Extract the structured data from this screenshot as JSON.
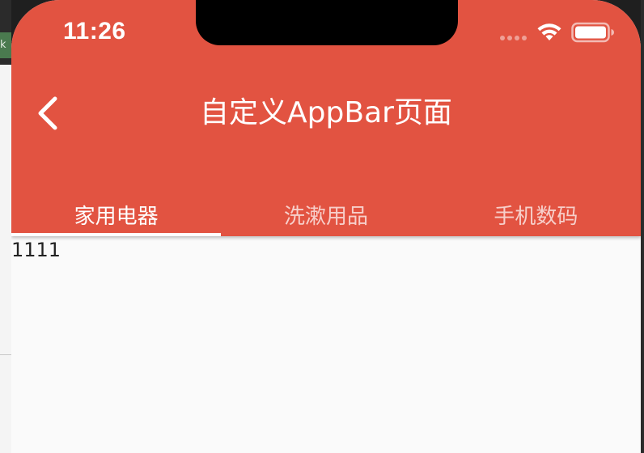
{
  "desktop": {
    "tab_fragment": "k"
  },
  "status_bar": {
    "time": "11:26",
    "icons": [
      "signal-dots-icon",
      "wifi-icon",
      "battery-icon"
    ]
  },
  "appbar": {
    "title": "自定义AppBar页面",
    "back_icon": "chevron-left-icon",
    "background_color": "#e25341"
  },
  "tabs": [
    {
      "label": "家用电器",
      "active": true
    },
    {
      "label": "洗漱用品",
      "active": false
    },
    {
      "label": "手机数码",
      "active": false
    }
  ],
  "content": {
    "text": "1111"
  }
}
